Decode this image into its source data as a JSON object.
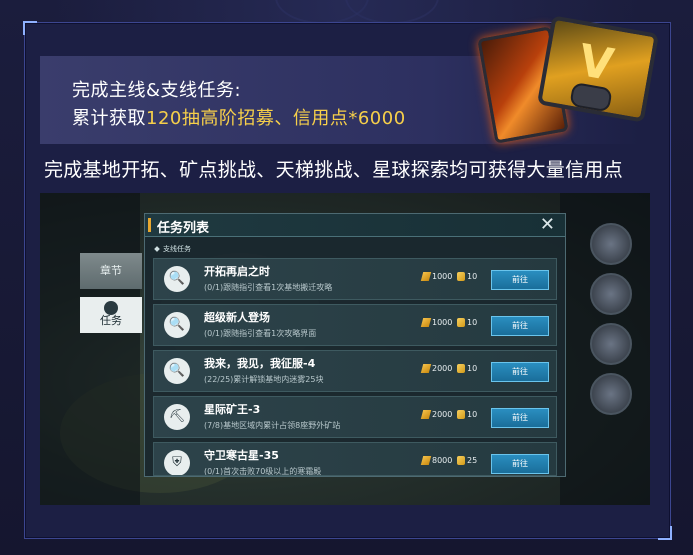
{
  "banner": {
    "line1": "完成主线&支线任务:",
    "line2_prefix": "累计获取",
    "line2_highlight": "120抽高阶招募、信用点*6000"
  },
  "subtitle": "完成基地开拓、矿点挑战、天梯挑战、星球探索均可获得大量信用点",
  "game": {
    "nav": {
      "chapter": "章节",
      "quest": "任务"
    },
    "panel": {
      "title": "任务列表",
      "section": "支线任务",
      "go_label": "前往",
      "quests": [
        {
          "name": "开拓再启之时",
          "desc": "(0/1)跟随指引查看1次基地搬迁攻略",
          "credit": "1000",
          "tickets": "10",
          "icon": "search-doc-icon"
        },
        {
          "name": "超级新人登场",
          "desc": "(0/1)跟随指引查看1次攻略界面",
          "credit": "1000",
          "tickets": "10",
          "icon": "search-doc-icon"
        },
        {
          "name": "我来，我见，我征服-4",
          "desc": "(22/25)累计解锁基地内迷雾25块",
          "credit": "2000",
          "tickets": "10",
          "icon": "search-doc-icon"
        },
        {
          "name": "星际矿王-3",
          "desc": "(7/8)基地区域内累计占领8座野外矿站",
          "credit": "2000",
          "tickets": "10",
          "icon": "miner-icon"
        },
        {
          "name": "守卫寒古星-35",
          "desc": "(0/1)首次击败70级以上的寒霜殿",
          "credit": "8000",
          "tickets": "25",
          "icon": "shield-icon"
        }
      ]
    }
  },
  "colors": {
    "highlight": "#f6cf4a",
    "accent": "#e8a830",
    "button": "#2a8ec0"
  }
}
